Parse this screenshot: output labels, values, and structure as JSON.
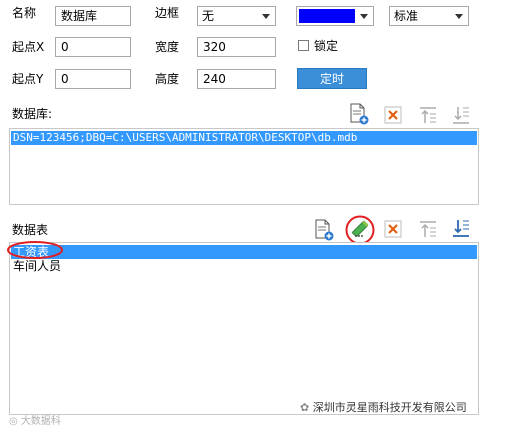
{
  "form": {
    "name_label": "名称",
    "name_value": "数据库",
    "border_label": "边框",
    "border_value": "无",
    "color_value": "#0000ff",
    "style_value": "标准",
    "x_label": "起点X",
    "x_value": "0",
    "width_label": "宽度",
    "width_value": "320",
    "lock_label": "锁定",
    "y_label": "起点Y",
    "y_value": "0",
    "height_label": "高度",
    "height_value": "240",
    "timer_button": "定时"
  },
  "database": {
    "label": "数据库:",
    "items": [
      "DSN=123456;DBQ=C:\\USERS\\ADMINISTRATOR\\DESKTOP\\db.mdb"
    ]
  },
  "tables": {
    "label": "数据表",
    "items": [
      "工资表",
      "车间人员"
    ]
  },
  "watermark": {
    "company": "深圳市灵星雨科技开发有限公司",
    "corner": "大数据科"
  },
  "colors": {
    "accent": "#3b8fd8",
    "selection": "#3399ff",
    "highlight_circle": "#e02020"
  }
}
